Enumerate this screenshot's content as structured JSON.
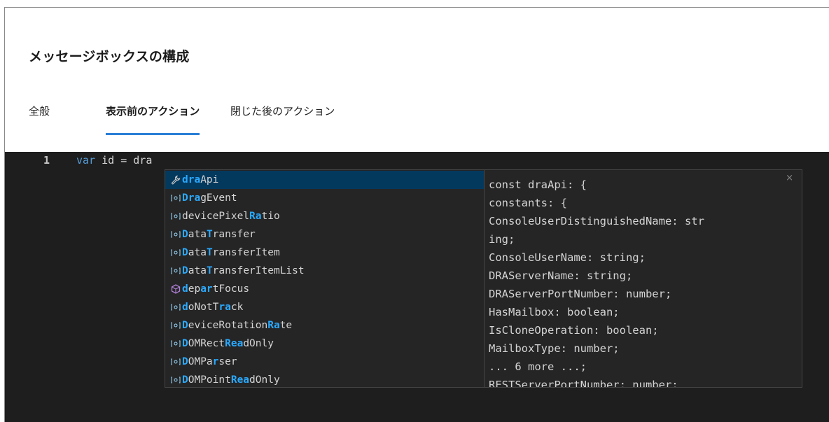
{
  "dialog": {
    "title": "メッセージボックスの構成",
    "tabs": [
      {
        "label": "全般"
      },
      {
        "label": "表示前のアクション"
      },
      {
        "label": "閉じた後のアクション"
      }
    ],
    "active_tab": "表示前のアクション"
  },
  "editor": {
    "line_number": "1",
    "keyword": "var",
    "code_rest": " id = dra"
  },
  "suggestions": [
    {
      "icon": "wrench-icon",
      "pre": "",
      "hl1": "dra",
      "mid": "Api",
      "hl2": "",
      "post": "",
      "selected": true
    },
    {
      "icon": "variable-icon",
      "pre": "",
      "hl1": "Dra",
      "mid": "gEvent",
      "hl2": "",
      "post": ""
    },
    {
      "icon": "variable-icon",
      "pre": "devicePixel",
      "hl1": "Ra",
      "mid": "tio",
      "hl2": "",
      "post": ""
    },
    {
      "icon": "variable-icon",
      "pre": "",
      "hl1": "D",
      "mid": "ata",
      "hl2": "T",
      "post": "ransfer"
    },
    {
      "icon": "variable-icon",
      "pre": "",
      "hl1": "D",
      "mid": "ata",
      "hl2": "T",
      "post": "ransferItem"
    },
    {
      "icon": "variable-icon",
      "pre": "",
      "hl1": "D",
      "mid": "ata",
      "hl2": "T",
      "post": "ransferItemList"
    },
    {
      "icon": "method-icon",
      "pre": "",
      "hl1": "d",
      "mid": "ep",
      "hl2": "ar",
      "post": "tFocus"
    },
    {
      "icon": "variable-icon",
      "pre": "",
      "hl1": "d",
      "mid": "oNotT",
      "hl2": "ra",
      "post": "ck"
    },
    {
      "icon": "variable-icon",
      "pre": "",
      "hl1": "D",
      "mid": "eviceRotation",
      "hl2": "Ra",
      "post": "te"
    },
    {
      "icon": "variable-icon",
      "pre": "",
      "hl1": "D",
      "mid": "OMRect",
      "hl2": "Rea",
      "post": "dOnly"
    },
    {
      "icon": "variable-icon",
      "pre": "",
      "hl1": "D",
      "mid": "OMPa",
      "hl2": "r",
      "post": "ser"
    },
    {
      "icon": "variable-icon",
      "pre": "",
      "hl1": "D",
      "mid": "OMPoint",
      "hl2": "Rea",
      "post": "dOnly"
    }
  ],
  "details": {
    "lines": [
      "const draApi: {",
      "constants: {",
      "ConsoleUserDistinguishedName: str",
      "ing;",
      "ConsoleUserName: string;",
      "DRAServerName: string;",
      "DRAServerPortNumber: number;",
      "HasMailbox: boolean;",
      "IsCloneOperation: boolean;",
      "MailboxType: number;",
      "... 6 more ...;",
      "RESTServerPortNumber: number;"
    ],
    "close_glyph": "×"
  },
  "colors": {
    "accent": "#2b7fd6",
    "editor_bg": "#1e1e1e",
    "selected_bg": "#04395e",
    "match_highlight": "#2aaaff",
    "keyword": "#569cd6"
  }
}
